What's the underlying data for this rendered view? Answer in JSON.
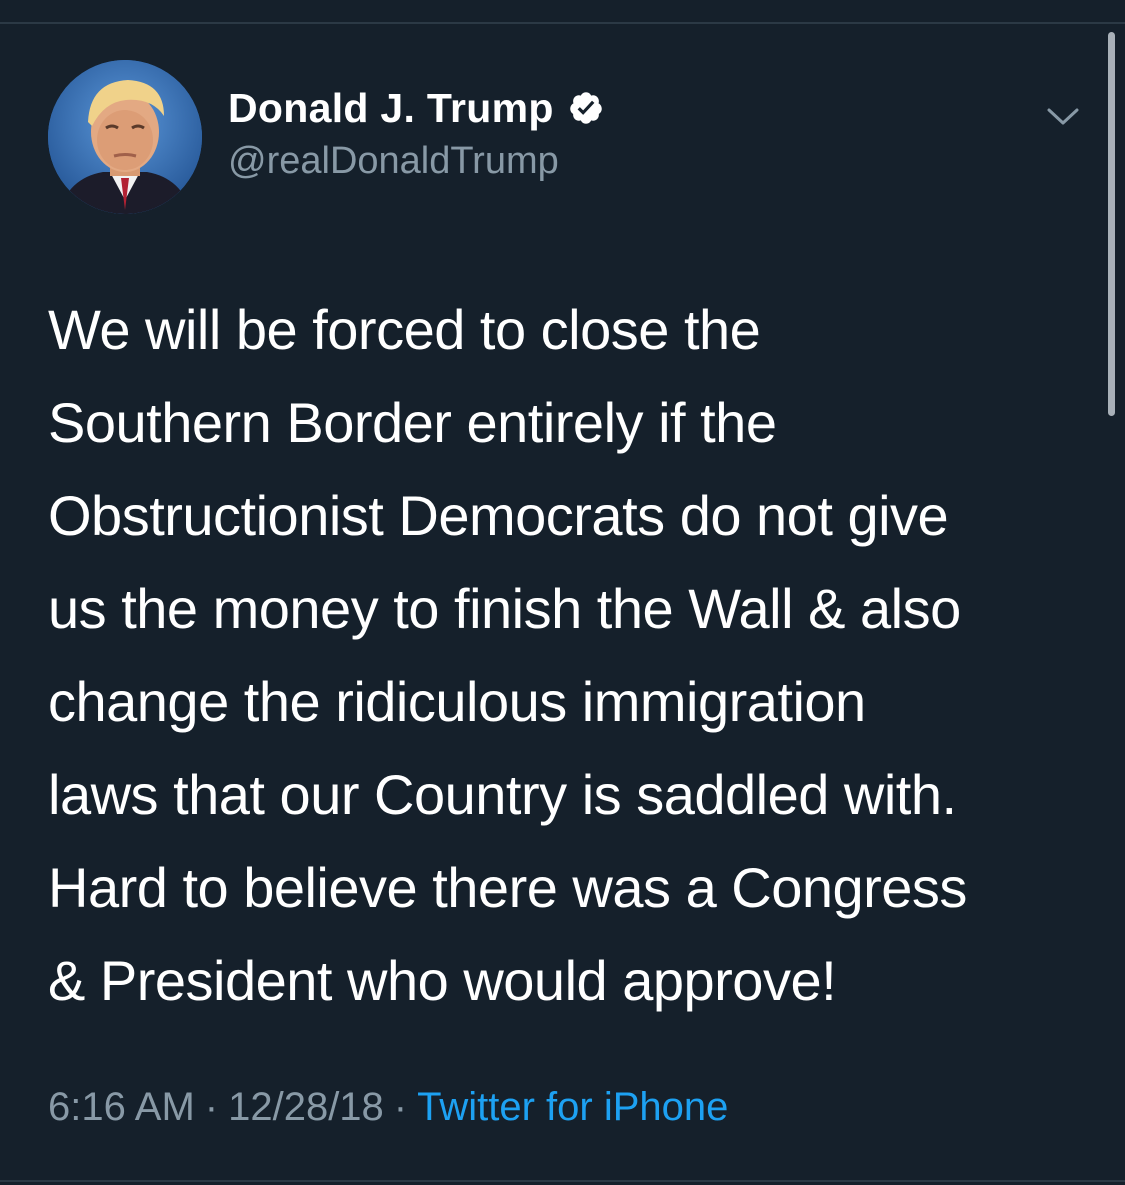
{
  "tweet": {
    "author": {
      "display_name": "Donald J. Trump",
      "handle": "@realDonaldTrump",
      "verified": true
    },
    "text_lines": [
      "We will be forced to close the",
      "Southern Border entirely if the",
      "Obstructionist Democrats do not give",
      "us the money to finish the Wall & also",
      "change the ridiculous immigration",
      "laws that our Country is saddled with.",
      "Hard to believe there was a Congress",
      "& President who would approve!"
    ],
    "meta": {
      "time": "6:16 AM",
      "separator": "·",
      "date": "12/28/18",
      "source": "Twitter for iPhone"
    }
  },
  "icons": {
    "verified": "verified-badge-icon",
    "more": "chevron-down-icon"
  },
  "colors": {
    "background": "#15202b",
    "text": "#ffffff",
    "secondary": "#8899a6",
    "link": "#1da1f2"
  }
}
